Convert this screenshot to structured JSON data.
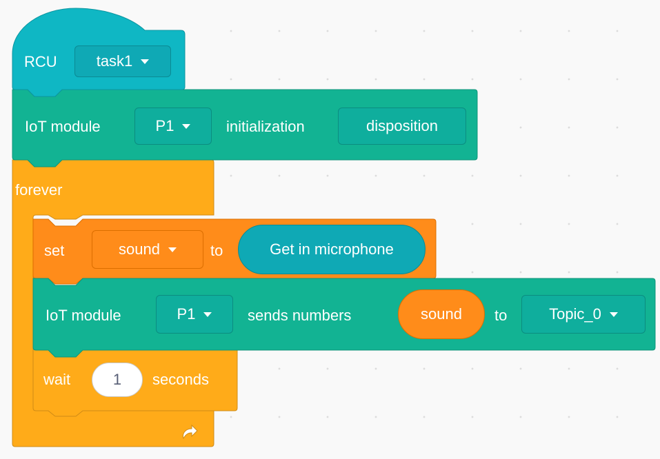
{
  "colors": {
    "hat_block": "#0fb7c4",
    "iot_block": "#12b393",
    "control_block": "#ffab19",
    "variable_block": "#ff8c1a",
    "reporter_teal": "#0fa9b5",
    "canvas": "#f9f9f9"
  },
  "hat": {
    "label": "RCU",
    "task_value": "task1"
  },
  "init_block": {
    "label": "IoT module",
    "port_value": "P1",
    "middle_label": "initialization",
    "config_label": "disposition"
  },
  "forever_block": {
    "label": "forever",
    "loop_icon": "loop-arrow-icon"
  },
  "set_block": {
    "label": "set",
    "variable_value": "sound",
    "to_label": "to",
    "reporter_label": "Get in microphone"
  },
  "send_block": {
    "label": "IoT module",
    "port_value": "P1",
    "middle_label": "sends numbers",
    "variable_reporter": "sound",
    "to_label": "to",
    "topic_value": "Topic_0"
  },
  "wait_block": {
    "label": "wait",
    "value": "1",
    "unit_label": "seconds"
  }
}
